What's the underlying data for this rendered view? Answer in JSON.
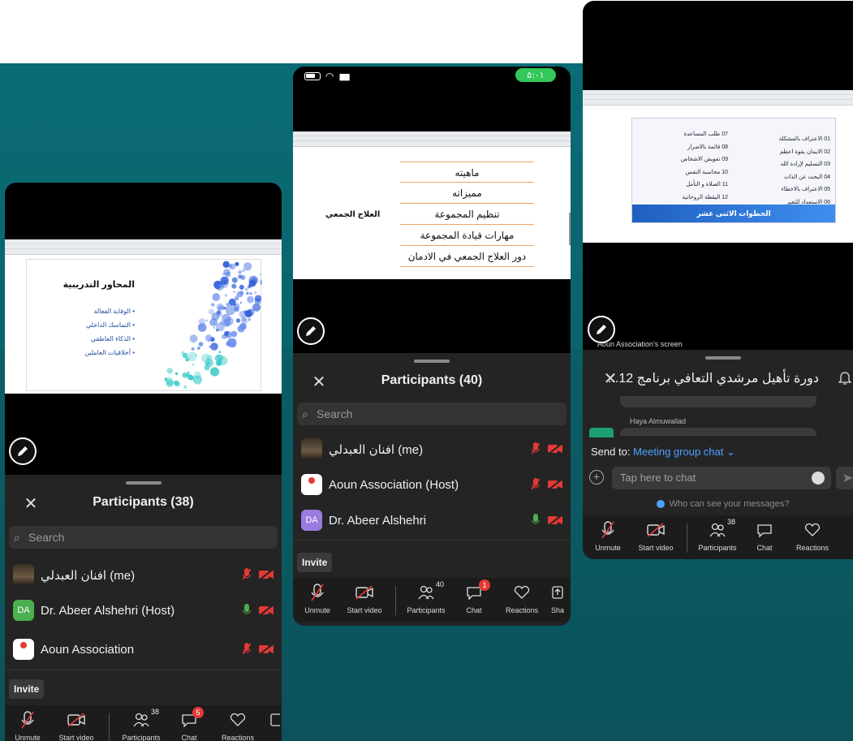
{
  "phone1": {
    "slide_title": "المحاور التدريبية",
    "slide_bullets": [
      "• الوقاية الفعالة",
      "• التماسك الداخلي",
      "• الذكاء العاطفي",
      "• أخلاقيات العاملين"
    ],
    "panel_title": "Participants (38)",
    "search_placeholder": "Search",
    "participants": [
      {
        "name": "افنان العبدلي (me)",
        "avatar": "",
        "mic": "muted",
        "video": "off"
      },
      {
        "name": "Dr. Abeer Alshehri (Host)",
        "avatar": "DA",
        "mic": "on",
        "video": "off"
      },
      {
        "name": "Aoun Association",
        "avatar": "",
        "mic": "muted",
        "video": "off"
      }
    ],
    "invite_label": "Invite",
    "toolbar": {
      "unmute": "Unmute",
      "start_video": "Start video",
      "participants": "Participants",
      "participants_count": "38",
      "chat": "Chat",
      "chat_badge": "5",
      "reactions": "Reactions"
    }
  },
  "phone2": {
    "status_time": "٥:٠١",
    "slide_label": "العلاج الجمعي",
    "slide_items": [
      "ماهيته",
      "مميزاته",
      "تنظيم المجموعة",
      "مهارات قيادة المجموعة",
      "دور العلاج الجمعي في الادمان"
    ],
    "panel_title": "Participants (40)",
    "search_placeholder": "Search",
    "participants": [
      {
        "name": "افنان العبدلي (me)",
        "avatar": "",
        "mic": "muted",
        "video": "off"
      },
      {
        "name": "Aoun Association (Host)",
        "avatar": "",
        "mic": "muted",
        "video": "off"
      },
      {
        "name": "Dr. Abeer Alshehri",
        "avatar": "DA",
        "mic": "on",
        "video": "off"
      }
    ],
    "invite_label": "Invite",
    "toolbar": {
      "unmute": "Unmute",
      "start_video": "Start video",
      "participants": "Participants",
      "participants_count": "40",
      "chat": "Chat",
      "chat_badge": "1",
      "reactions": "Reactions",
      "share": "Sha"
    }
  },
  "phone3": {
    "slide_footer": "الخطوات الاثنى عشر",
    "slide_steps_right": [
      "01 الاعتراف بالمشكلة",
      "02 الايمان بقوة اعظم",
      "03 التسليم لإرادة الله",
      "04 البحث عن الذات",
      "05 الاعتراف بالاخطاء",
      "06 الاستعداد للتغير"
    ],
    "slide_steps_left": [
      "07 طلب المساعدة",
      "08 قائمة بالاضرار",
      "09 تعويض الاشخاص",
      "10 محاسبة النفس",
      "11 الصلاة و التأمل",
      "12 اليقظة الروحانية"
    ],
    "screen_label": "Aoun Association's screen",
    "chat_title": "دورة تأهيل مرشدي التعافي برنامج 12...",
    "chat_sender": "Haya Almuwallad",
    "send_to_label": "Send to:",
    "send_to_target": "Meeting group chat",
    "chat_placeholder": "Tap here to chat",
    "who_can_see": "Who can see your messages?",
    "toolbar": {
      "unmute": "Unmute",
      "start_video": "Start video",
      "participants": "Participants",
      "participants_count": "38",
      "chat": "Chat",
      "reactions": "Reactions"
    }
  }
}
